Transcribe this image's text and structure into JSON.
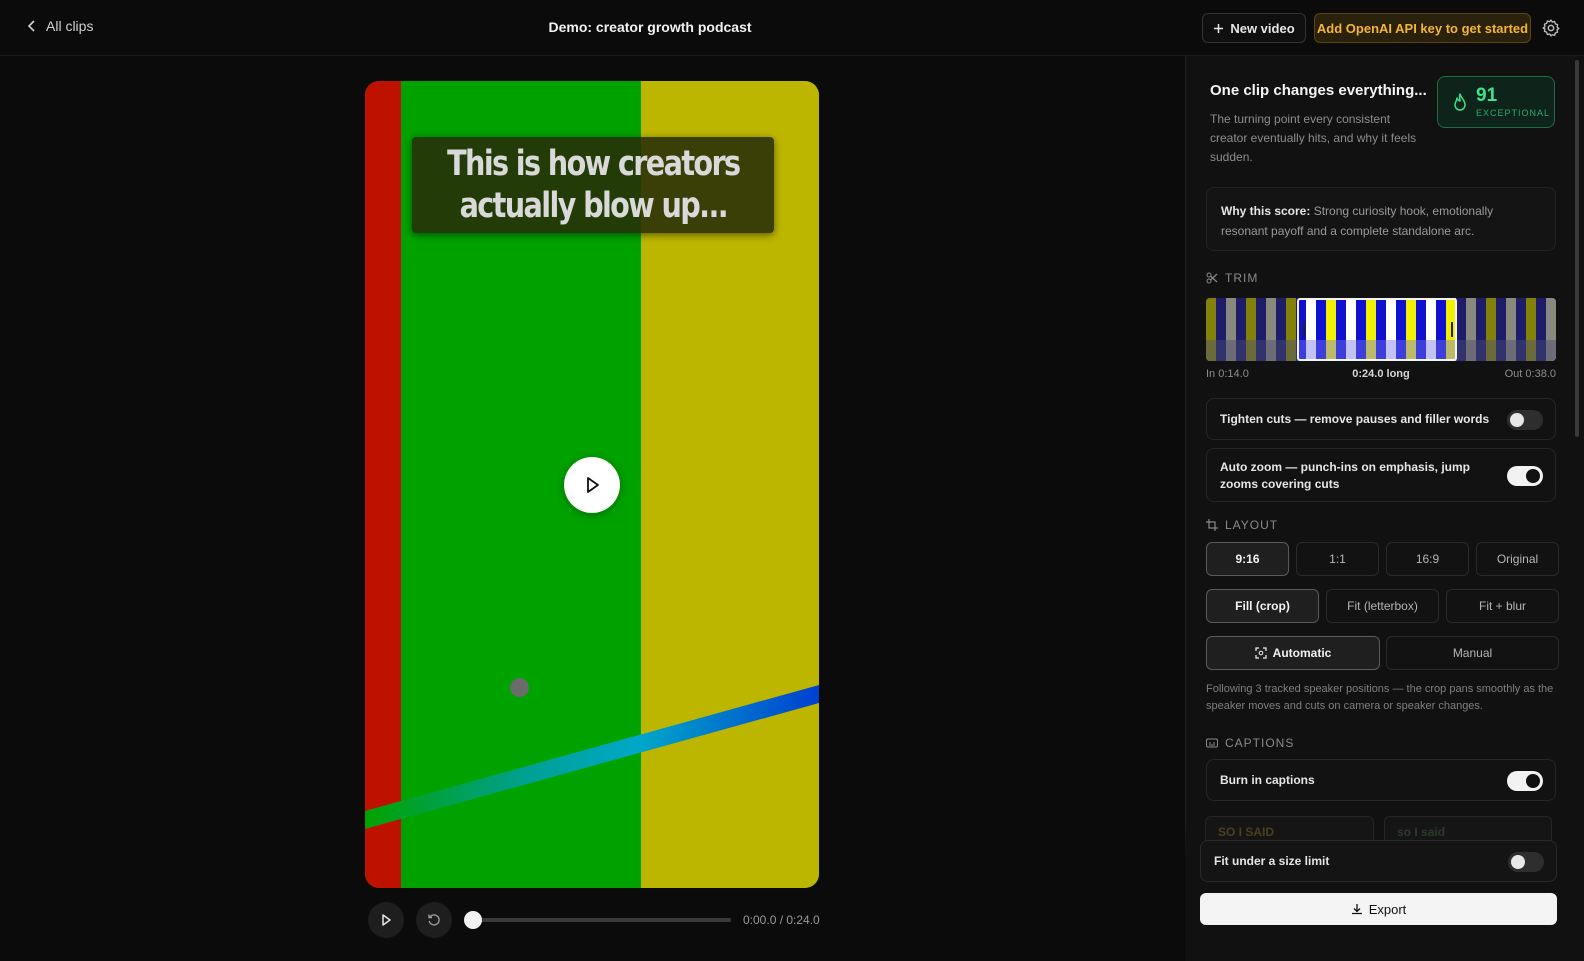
{
  "header": {
    "back_label": "All clips",
    "title": "Demo: creator growth podcast",
    "new_video_label": "New video",
    "api_key_label": "Add OpenAI API key to get started",
    "accent_color": "#f5b534"
  },
  "player": {
    "caption": "This is how creators\nactually blow up...",
    "time": "0:00.0 / 0:24.0",
    "progress": 0.0
  },
  "clip": {
    "title": "One clip changes everything...",
    "description": "The turning point every consistent creator eventually hits, and why it feels sudden.",
    "score": "91",
    "score_label": "EXCEPTIONAL",
    "score_color": "#3fe08a",
    "why_label": "Why this score:",
    "why_text": " Strong curiosity hook, emotionally resonant payoff and a complete standalone arc."
  },
  "trim": {
    "heading": "TRIM",
    "in": "In 0:14.0",
    "length": "0:24.0 long",
    "out": "Out 0:38.0"
  },
  "toggles": {
    "tighten_label": "Tighten cuts — remove pauses and filler words",
    "tighten_on": false,
    "autozoom_label": "Auto zoom — punch-ins on emphasis, jump zooms covering cuts",
    "autozoom_on": true
  },
  "layout": {
    "heading": "LAYOUT",
    "ratios": [
      "9:16",
      "1:1",
      "16:9",
      "Original"
    ],
    "ratio_selected": "9:16",
    "fits": [
      "Fill (crop)",
      "Fit (letterbox)",
      "Fit + blur"
    ],
    "fit_selected": "Fill (crop)",
    "modes": [
      "Automatic",
      "Manual"
    ],
    "mode_selected": "Automatic",
    "note": "Following 3 tracked speaker positions — the crop pans smoothly as the speaker moves and cuts on camera or speaker changes."
  },
  "captions": {
    "heading": "CAPTIONS",
    "burn_label": "Burn in captions",
    "burn_on": true,
    "preview_1": "SO I SAID",
    "preview_2": "so I said"
  },
  "export": {
    "size_limit_label": "Fit under a size limit",
    "size_limit_on": false,
    "export_label": "Export"
  }
}
